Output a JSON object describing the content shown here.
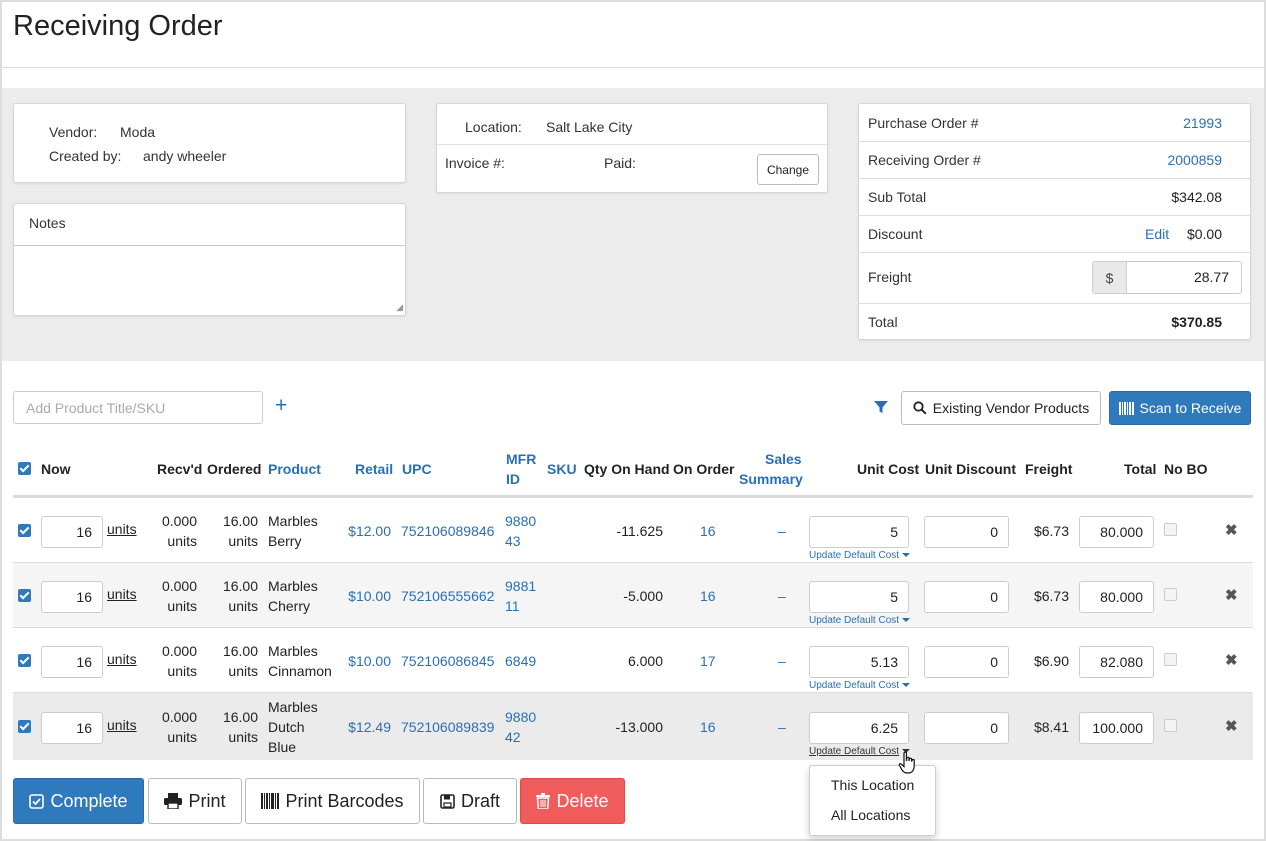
{
  "page": {
    "title": "Receiving Order"
  },
  "vendor_card": {
    "vendor_label": "Vendor:",
    "vendor_value": "Moda",
    "created_label": "Created by:",
    "created_value": "andy wheeler"
  },
  "notes": {
    "label": "Notes",
    "value": ""
  },
  "location_card": {
    "location_label": "Location:",
    "location_value": "Salt Lake City",
    "invoice_label": "Invoice #:",
    "paid_label": "Paid:",
    "change_button": "Change"
  },
  "summary": {
    "po_label": "Purchase Order #",
    "po_value": "21993",
    "ro_label": "Receiving Order #",
    "ro_value": "2000859",
    "subtotal_label": "Sub Total",
    "subtotal_value": "$342.08",
    "discount_label": "Discount",
    "discount_edit": "Edit",
    "discount_value": "$0.00",
    "freight_label": "Freight",
    "freight_addon": "$",
    "freight_value": "28.77",
    "total_label": "Total",
    "total_value": "$370.85"
  },
  "toolbar": {
    "add_product_placeholder": "Add Product Title/SKU",
    "add_icon": "plus-icon",
    "filter_icon": "filter-icon",
    "existing_vendor_products": "Existing Vendor Products",
    "scan_to_receive": "Scan to Receive"
  },
  "table": {
    "headers": {
      "now": "Now",
      "recvd": "Recv'd",
      "ordered": "Ordered",
      "product": "Product",
      "retail": "Retail",
      "upc": "UPC",
      "mfr_id_1": "MFR",
      "mfr_id_2": "ID",
      "sku": "SKU",
      "qty_on_hand": "Qty On Hand",
      "on_order": "On Order",
      "sales_summary_1": "Sales",
      "sales_summary_2": "Summary",
      "unit_cost": "Unit Cost",
      "unit_discount": "Unit Discount",
      "freight": "Freight",
      "total": "Total",
      "no_bo": "No BO"
    },
    "rows": [
      {
        "now": "16",
        "units": "units",
        "recvd_1": "0.000",
        "recvd_2": "units",
        "ordered_1": "16.00",
        "ordered_2": "units",
        "product_1": "Marbles",
        "product_2": "Berry",
        "product_3": "",
        "retail": "$12.00",
        "upc": "752106089846",
        "mfr_1": "9880",
        "mfr_2": "43",
        "qty": "-11.625",
        "on_order": "16",
        "sales": "–",
        "unit_cost": "5",
        "udc": "Update Default Cost",
        "unit_discount": "0",
        "freight": "$6.73",
        "total": "80.000"
      },
      {
        "now": "16",
        "units": "units",
        "recvd_1": "0.000",
        "recvd_2": "units",
        "ordered_1": "16.00",
        "ordered_2": "units",
        "product_1": "Marbles",
        "product_2": "Cherry",
        "product_3": "",
        "retail": "$10.00",
        "upc": "752106555662",
        "mfr_1": "9881",
        "mfr_2": "11",
        "qty": "-5.000",
        "on_order": "16",
        "sales": "–",
        "unit_cost": "5",
        "udc": "Update Default Cost",
        "unit_discount": "0",
        "freight": "$6.73",
        "total": "80.000"
      },
      {
        "now": "16",
        "units": "units",
        "recvd_1": "0.000",
        "recvd_2": "units",
        "ordered_1": "16.00",
        "ordered_2": "units",
        "product_1": "Marbles",
        "product_2": "Cinnamon",
        "product_3": "",
        "retail": "$10.00",
        "upc": "752106086845",
        "mfr_1": "6849",
        "mfr_2": "",
        "qty": "6.000",
        "on_order": "17",
        "sales": "–",
        "unit_cost": "5.13",
        "udc": "Update Default Cost",
        "unit_discount": "0",
        "freight": "$6.90",
        "total": "82.080"
      },
      {
        "now": "16",
        "units": "units",
        "recvd_1": "0.000",
        "recvd_2": "units",
        "ordered_1": "16.00",
        "ordered_2": "units",
        "product_1": "Marbles",
        "product_2": "Dutch",
        "product_3": "Blue",
        "retail": "$12.49",
        "upc": "752106089839",
        "mfr_1": "9880",
        "mfr_2": "42",
        "qty": "-13.000",
        "on_order": "16",
        "sales": "–",
        "unit_cost": "6.25",
        "udc": "Update Default Cost",
        "unit_discount": "0",
        "freight": "$8.41",
        "total": "100.000"
      }
    ]
  },
  "dropdown": {
    "option_1": "This Location",
    "option_2": "All Locations"
  },
  "actions": {
    "complete": "Complete",
    "print": "Print",
    "print_barcodes": "Print Barcodes",
    "draft": "Draft",
    "delete": "Delete"
  },
  "colors": {
    "accent": "#2f79bd",
    "link": "#2a6fb5",
    "danger": "#f05c5c"
  }
}
